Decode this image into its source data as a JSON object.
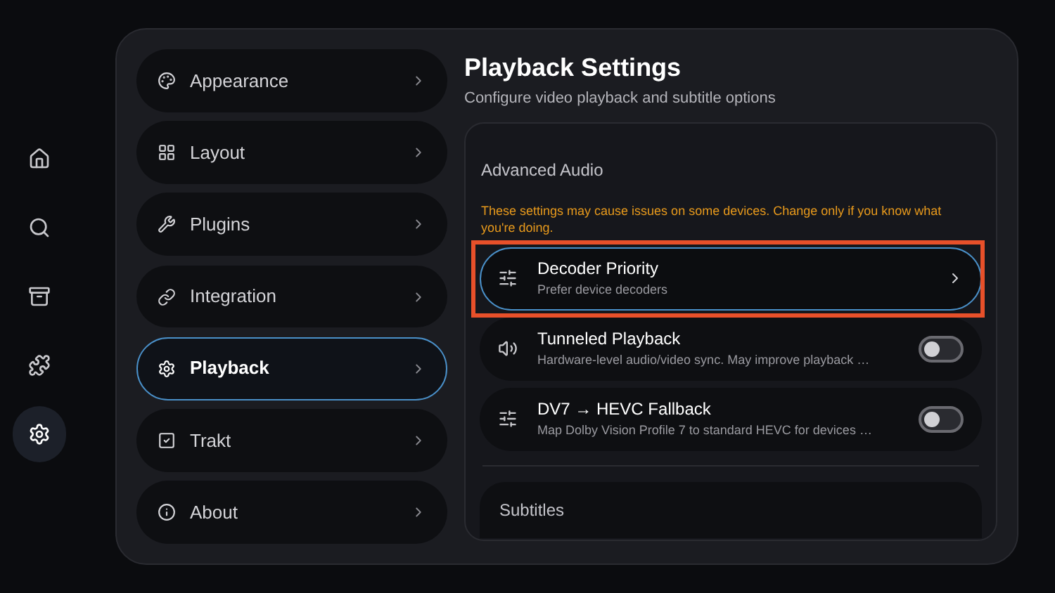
{
  "rail": [
    {
      "selected": false
    },
    {
      "selected": false
    },
    {
      "selected": false
    },
    {
      "selected": false
    },
    {
      "selected": true
    }
  ],
  "menu": [
    {
      "label": "Appearance",
      "selected": false
    },
    {
      "label": "Layout",
      "selected": false
    },
    {
      "label": "Plugins",
      "selected": false
    },
    {
      "label": "Integration",
      "selected": false
    },
    {
      "label": "Playback",
      "selected": true
    },
    {
      "label": "Trakt",
      "selected": false
    },
    {
      "label": "About",
      "selected": false
    }
  ],
  "page": {
    "title": "Playback Settings",
    "subtitle": "Configure video playback and subtitle options"
  },
  "section": {
    "title": "Advanced Audio",
    "warning": "These settings may cause issues on some devices. Change only if you know what you're doing.",
    "rows": [
      {
        "kind": "link",
        "title": "Decoder Priority",
        "description": "Prefer device decoders",
        "selected": true,
        "highlighted": true
      },
      {
        "kind": "toggle",
        "title": "Tunneled Playback",
        "description": "Hardware-level audio/video sync. May improve playback …",
        "on": false,
        "selected": false,
        "highlighted": false
      },
      {
        "kind": "toggle",
        "title": "DV7 → HEVC Fallback",
        "description": "Map Dolby Vision Profile 7 to standard HEVC for devices …",
        "on": false,
        "selected": false,
        "highlighted": false
      }
    ]
  },
  "next_section": {
    "title": "Subtitles"
  }
}
